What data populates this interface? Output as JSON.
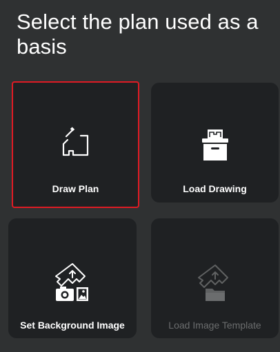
{
  "header": {
    "title": "Select the plan used as a basis"
  },
  "options": [
    {
      "label": "Draw Plan",
      "icon": "draw-plan-icon",
      "selected": true,
      "enabled": true
    },
    {
      "label": "Load Drawing",
      "icon": "load-drawing-icon",
      "selected": false,
      "enabled": true
    },
    {
      "label": "Set Background Image",
      "icon": "set-background-image-icon",
      "selected": false,
      "enabled": true
    },
    {
      "label": "Load Image Template",
      "icon": "load-image-template-icon",
      "selected": false,
      "enabled": false
    }
  ],
  "colors": {
    "background": "#2f3132",
    "card": "#1f2123",
    "selection_outline": "#e01b24",
    "text": "#ffffff",
    "text_disabled": "#6b6d6e"
  }
}
